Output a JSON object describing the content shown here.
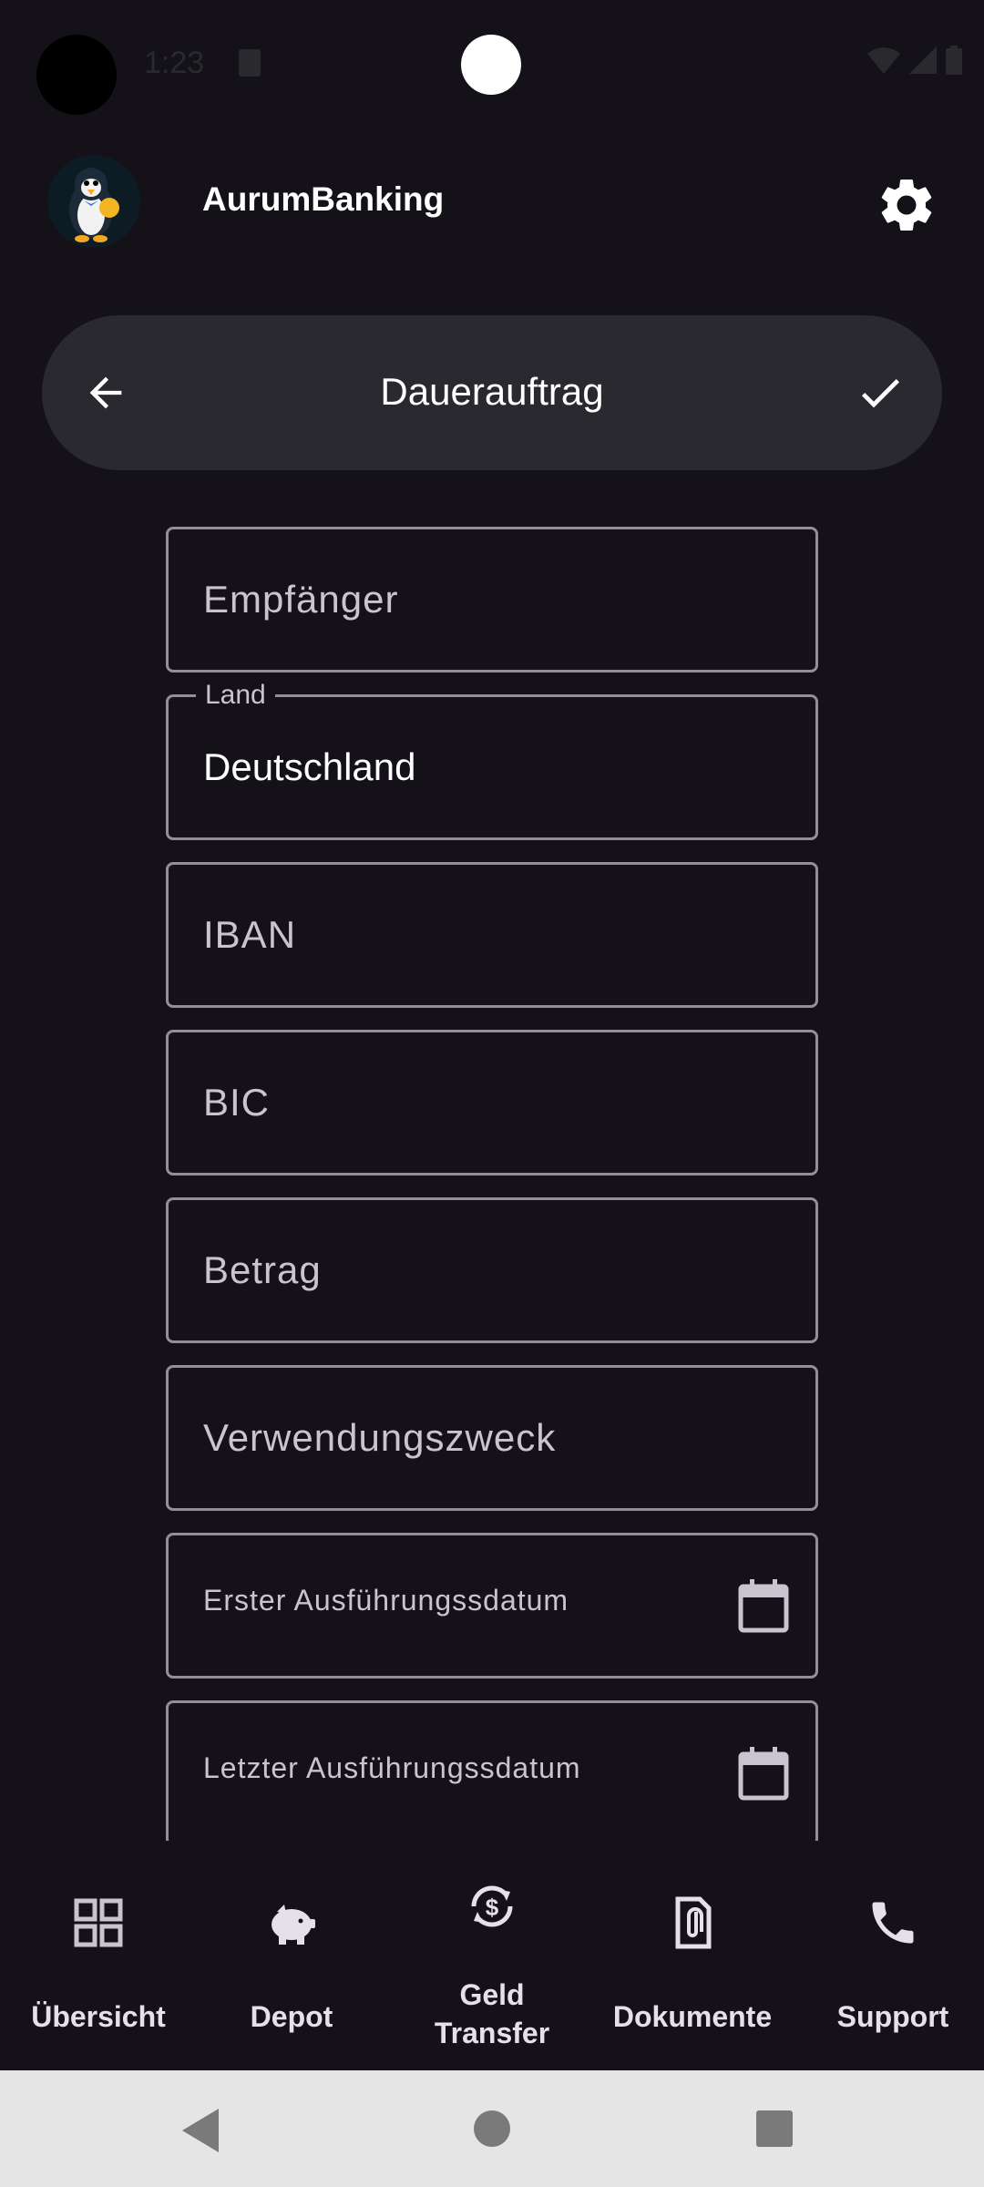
{
  "status_bar": {
    "time": "1:23"
  },
  "header": {
    "app_name": "AurumBanking"
  },
  "top_bar": {
    "title": "Dauerauftrag"
  },
  "form": {
    "recipient": {
      "placeholder": "Empfänger",
      "value": ""
    },
    "country": {
      "label": "Land",
      "value": "Deutschland"
    },
    "iban": {
      "placeholder": "IBAN",
      "value": ""
    },
    "bic": {
      "placeholder": "BIC",
      "value": ""
    },
    "amount": {
      "placeholder": "Betrag",
      "value": ""
    },
    "purpose": {
      "placeholder": "Verwendungszweck",
      "value": ""
    },
    "first_date": {
      "placeholder": "Erster Ausführungssdatum",
      "value": ""
    },
    "last_date": {
      "placeholder": "Letzter Ausführungssdatum",
      "value": ""
    }
  },
  "bottom_nav": {
    "items": [
      {
        "label": "Übersicht",
        "icon": "grid-icon"
      },
      {
        "label": "Depot",
        "icon": "piggy-bank-icon"
      },
      {
        "label": "Geld\nTransfer",
        "icon": "currency-exchange-icon"
      },
      {
        "label": "Dokumente",
        "icon": "file-attachment-icon"
      },
      {
        "label": "Support",
        "icon": "phone-icon"
      }
    ]
  },
  "colors": {
    "background": "#141218",
    "surface": "#2B2930",
    "outline": "#938F99",
    "on_surface": "#E6E0E9"
  }
}
